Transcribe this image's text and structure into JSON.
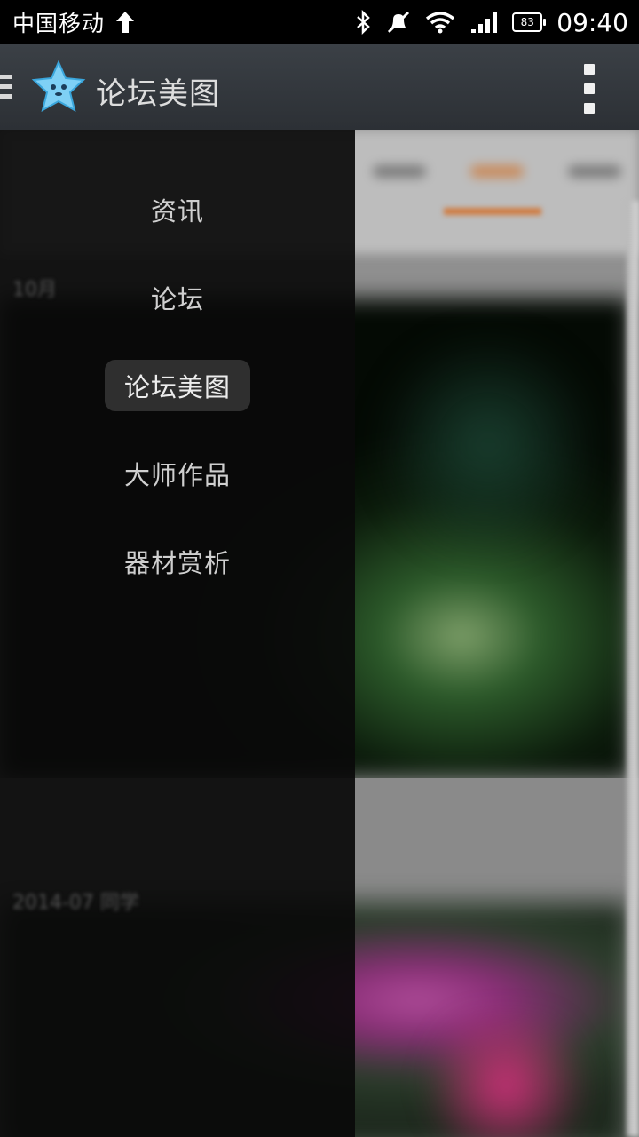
{
  "status_bar": {
    "carrier": "中国移动",
    "battery": "83",
    "time": "09:40"
  },
  "action_bar": {
    "title": "论坛美图"
  },
  "drawer": {
    "items": [
      {
        "label": "资讯"
      },
      {
        "label": "论坛"
      },
      {
        "label": "论坛美图",
        "active": true
      },
      {
        "label": "大师作品"
      },
      {
        "label": "器材赏析"
      }
    ]
  },
  "background": {
    "row1_text": "10月",
    "row2_text": "2014-07 同学"
  },
  "colors": {
    "accent": "#d07a3e",
    "drawer_bg": "#0a0a0a",
    "actionbar_bg": "#34393e"
  }
}
